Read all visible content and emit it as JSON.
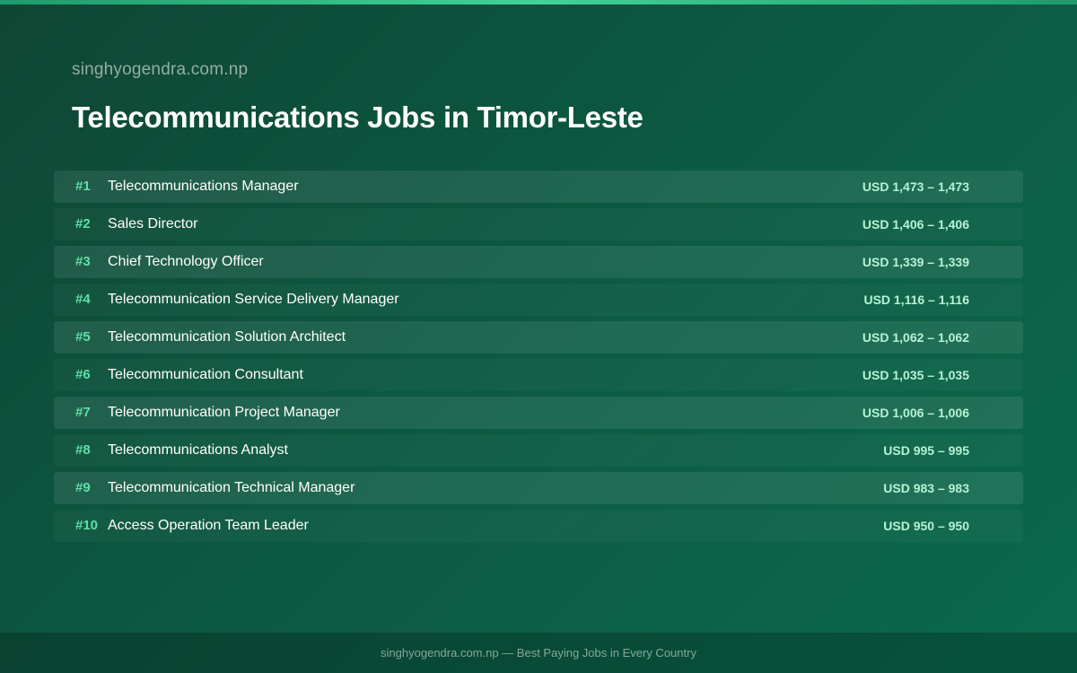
{
  "header": {
    "site": "singhyogendra.com.np",
    "title": "Telecommunications Jobs in Timor-Leste"
  },
  "jobs": [
    {
      "rank": "#1",
      "title": "Telecommunications Manager",
      "salary": "USD 1,473 – 1,473"
    },
    {
      "rank": "#2",
      "title": "Sales Director",
      "salary": "USD 1,406 – 1,406"
    },
    {
      "rank": "#3",
      "title": "Chief Technology Officer",
      "salary": "USD 1,339 – 1,339"
    },
    {
      "rank": "#4",
      "title": "Telecommunication Service Delivery Manager",
      "salary": "USD 1,116 – 1,116"
    },
    {
      "rank": "#5",
      "title": "Telecommunication Solution Architect",
      "salary": "USD 1,062 – 1,062"
    },
    {
      "rank": "#6",
      "title": "Telecommunication Consultant",
      "salary": "USD 1,035 – 1,035"
    },
    {
      "rank": "#7",
      "title": "Telecommunication Project Manager",
      "salary": "USD 1,006 – 1,006"
    },
    {
      "rank": "#8",
      "title": "Telecommunications Analyst",
      "salary": "USD 995 – 995"
    },
    {
      "rank": "#9",
      "title": "Telecommunication Technical Manager",
      "salary": "USD 983 – 983"
    },
    {
      "rank": "#10",
      "title": "Access Operation Team Leader",
      "salary": "USD 950 – 950"
    }
  ],
  "footer": {
    "text": "singhyogendra.com.np — Best Paying Jobs in Every Country"
  },
  "colors": {
    "accent": "#3fd39a",
    "rank": "#5ee0a8",
    "salary": "#b7f2d4"
  }
}
